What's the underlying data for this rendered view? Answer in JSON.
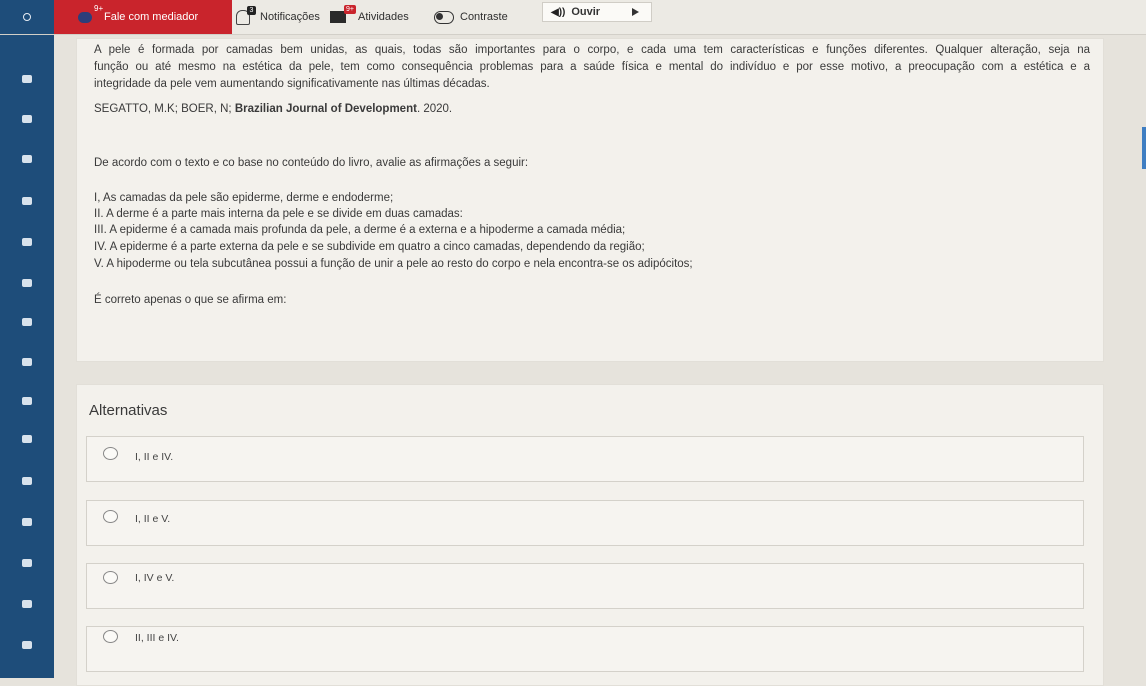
{
  "topbar": {
    "mediator_label": "Fale com mediador",
    "mediator_badge": "9+",
    "notifications_label": "Notificações",
    "notifications_badge": "3",
    "activities_label": "Atividades",
    "activities_badge": "9+",
    "contrast_label": "Contraste",
    "listen_label": "Ouvir"
  },
  "question": {
    "text_excerpt": "A pele é formada por camadas bem unidas, as quais, todas são importantes para o corpo, e cada uma tem características e funções diferentes. Qualquer alteração, seja na função ou até mesmo na estética da pele, tem como consequência problemas para a saúde física e mental do indivíduo e por esse motivo, a preocupação com a estética e a integridade da pele vem aumentando significativamente nas últimas décadas.",
    "line1": "A pele é formada por camadas bem unidas, as quais, todas são importantes para o corpo, e cada uma tem características e funções diferentes. Qualquer alteração, seja na",
    "line2": "função ou até mesmo na estética da pele, tem como consequência problemas para a saúde física e mental do indivíduo e por esse motivo, a preocupação com a estética e a",
    "line3": "integridade da pele vem aumentando significativamente nas últimas décadas.",
    "citation_authors": "SEGATTO, M.K; BOER, N;",
    "citation_journal": "Brazilian Journal of Development",
    "citation_year": ". 2020.",
    "prompt": "De acordo com o texto e co base no conteúdo do livro, avalie as afirmações a seguir:",
    "statements": [
      "I, As camadas da pele são epiderme, derme e endoderme;",
      "II.  A derme é a parte mais interna da pele e se divide em duas camadas:",
      "III. A epiderme é a camada mais profunda da pele, a derme é a externa e a hipoderme a camada média;",
      "IV. A epiderme é a parte externa da pele e se subdivide em quatro a cinco camadas, dependendo da região;",
      "V.  A hipoderme ou tela subcutânea possui a função de unir a pele ao resto do corpo e nela encontra-se os adipócitos;"
    ],
    "ask": "É correto apenas o que se afirma em:"
  },
  "alternatives": {
    "title": "Alternativas",
    "options": [
      "I, II e IV.",
      "I, II e V.",
      "I, IV e V.",
      "II, III e IV."
    ]
  }
}
